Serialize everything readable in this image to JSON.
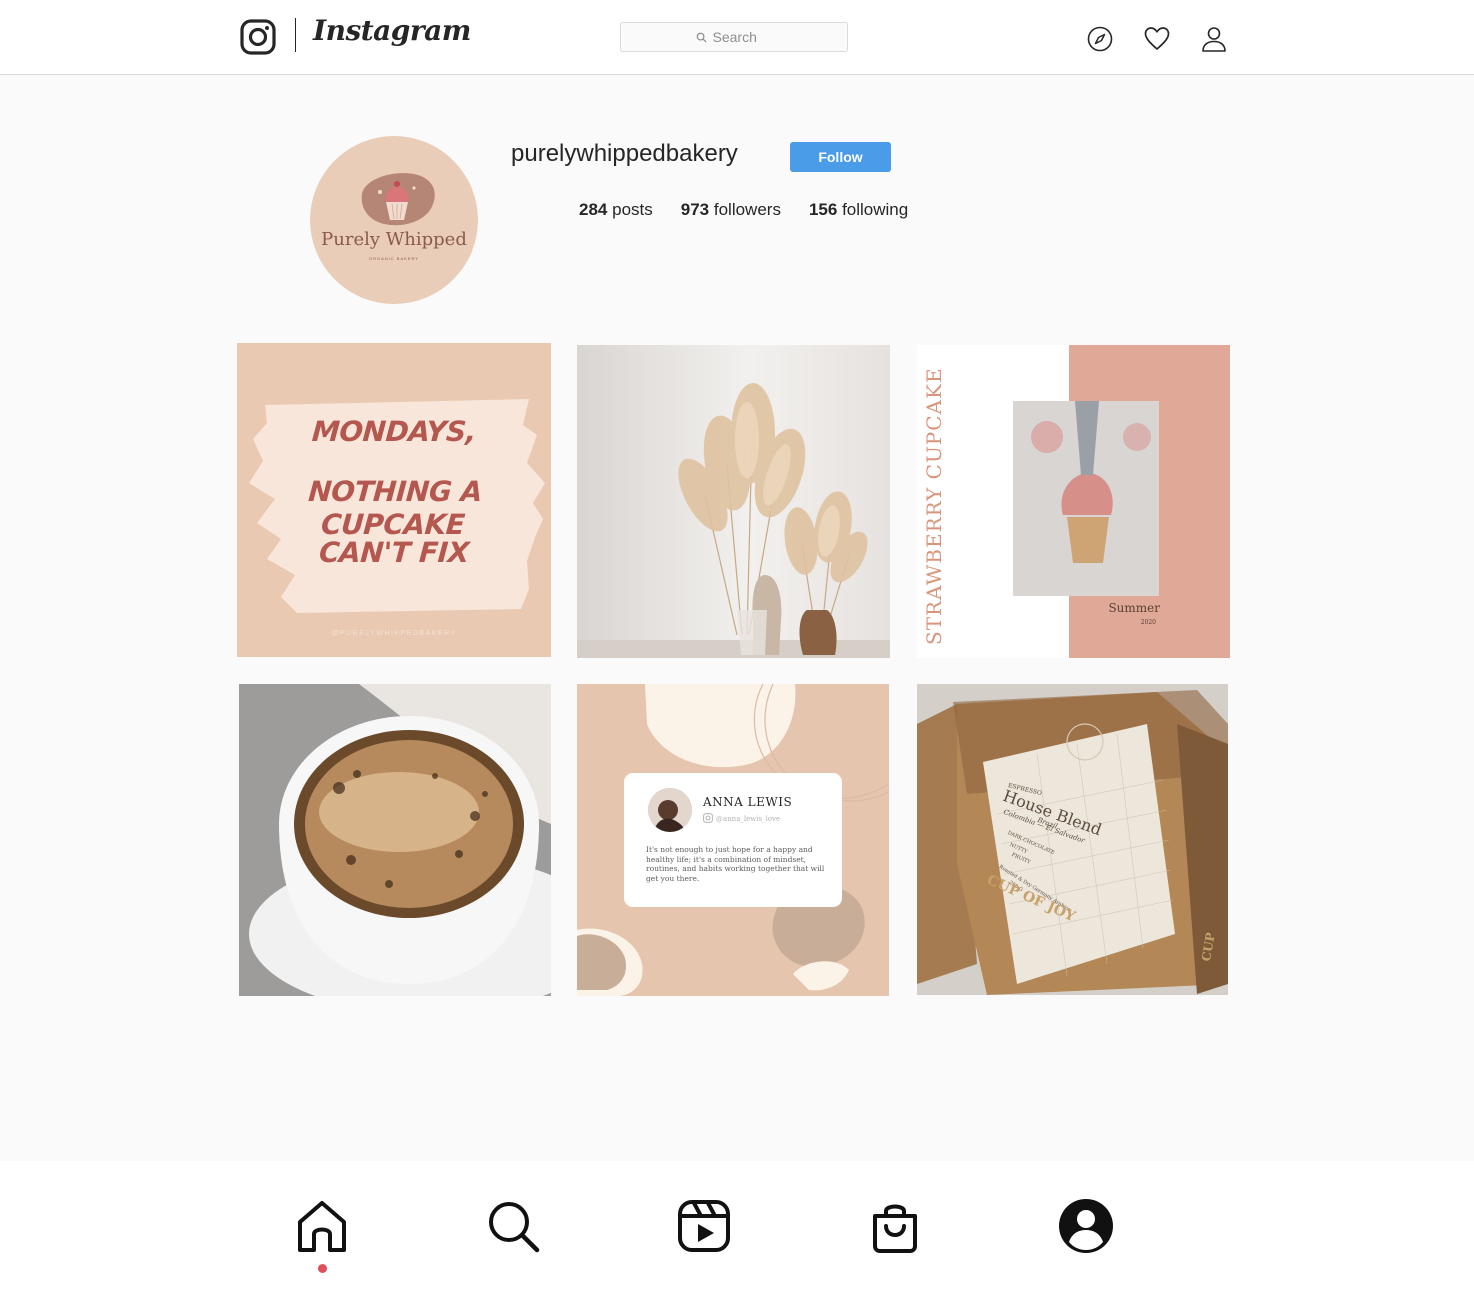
{
  "header": {
    "wordmark": "Instagram",
    "search_placeholder": "Search",
    "icons": [
      "instagram-glyph-icon",
      "compass-icon",
      "heart-icon",
      "user-icon"
    ]
  },
  "profile": {
    "username": "purelywhippedbakery",
    "follow_label": "Follow",
    "avatar_brand": "Purely Whipped",
    "avatar_tagline": "ORGANIC BAKERY",
    "stats": [
      {
        "value": "284",
        "label": "posts"
      },
      {
        "value": "973",
        "label": "followers"
      },
      {
        "value": "156",
        "label": "following"
      }
    ]
  },
  "posts": {
    "quote": {
      "line1": "MONDAYS,",
      "line2": "NOTHING A CUPCAKE",
      "line3": "CAN'T FIX",
      "handle": "@PURELYWHIPPEDBAKERY"
    },
    "cupcake": {
      "vertical_title": "STRAWBERRY CUPCAKE",
      "season": "Summer",
      "year": "2020"
    },
    "testimonial": {
      "name": "ANNA LEWIS",
      "handle": "@anna_lewis_love",
      "text": "It's not enough to just hope for a happy and healthy life; it's a combination of mindset, routines, and habits working together that will get you there."
    },
    "package": {
      "small": "ESPRESSO",
      "title": "House Blend",
      "origin": "Colombia — El Salvador",
      "country": "Brazil",
      "notes1": "DARK CHOCOLATE",
      "notes2": "NUTTY",
      "notes3": "FRUITY",
      "roast": "Roasted & Dry Germany Arabica",
      "weight": "250 G",
      "brand": "CUP OF JOY",
      "side_brand": "CUP"
    }
  },
  "colors": {
    "accent": "#4a9be8",
    "avatar_bg": "#e9cdb8",
    "quote_text": "#b4574f",
    "nav_dot": "#e0505a"
  },
  "bottom_nav": {
    "items": [
      "home-icon",
      "search-icon",
      "reels-icon",
      "shop-icon",
      "profile-icon"
    ],
    "active": "home-icon"
  }
}
